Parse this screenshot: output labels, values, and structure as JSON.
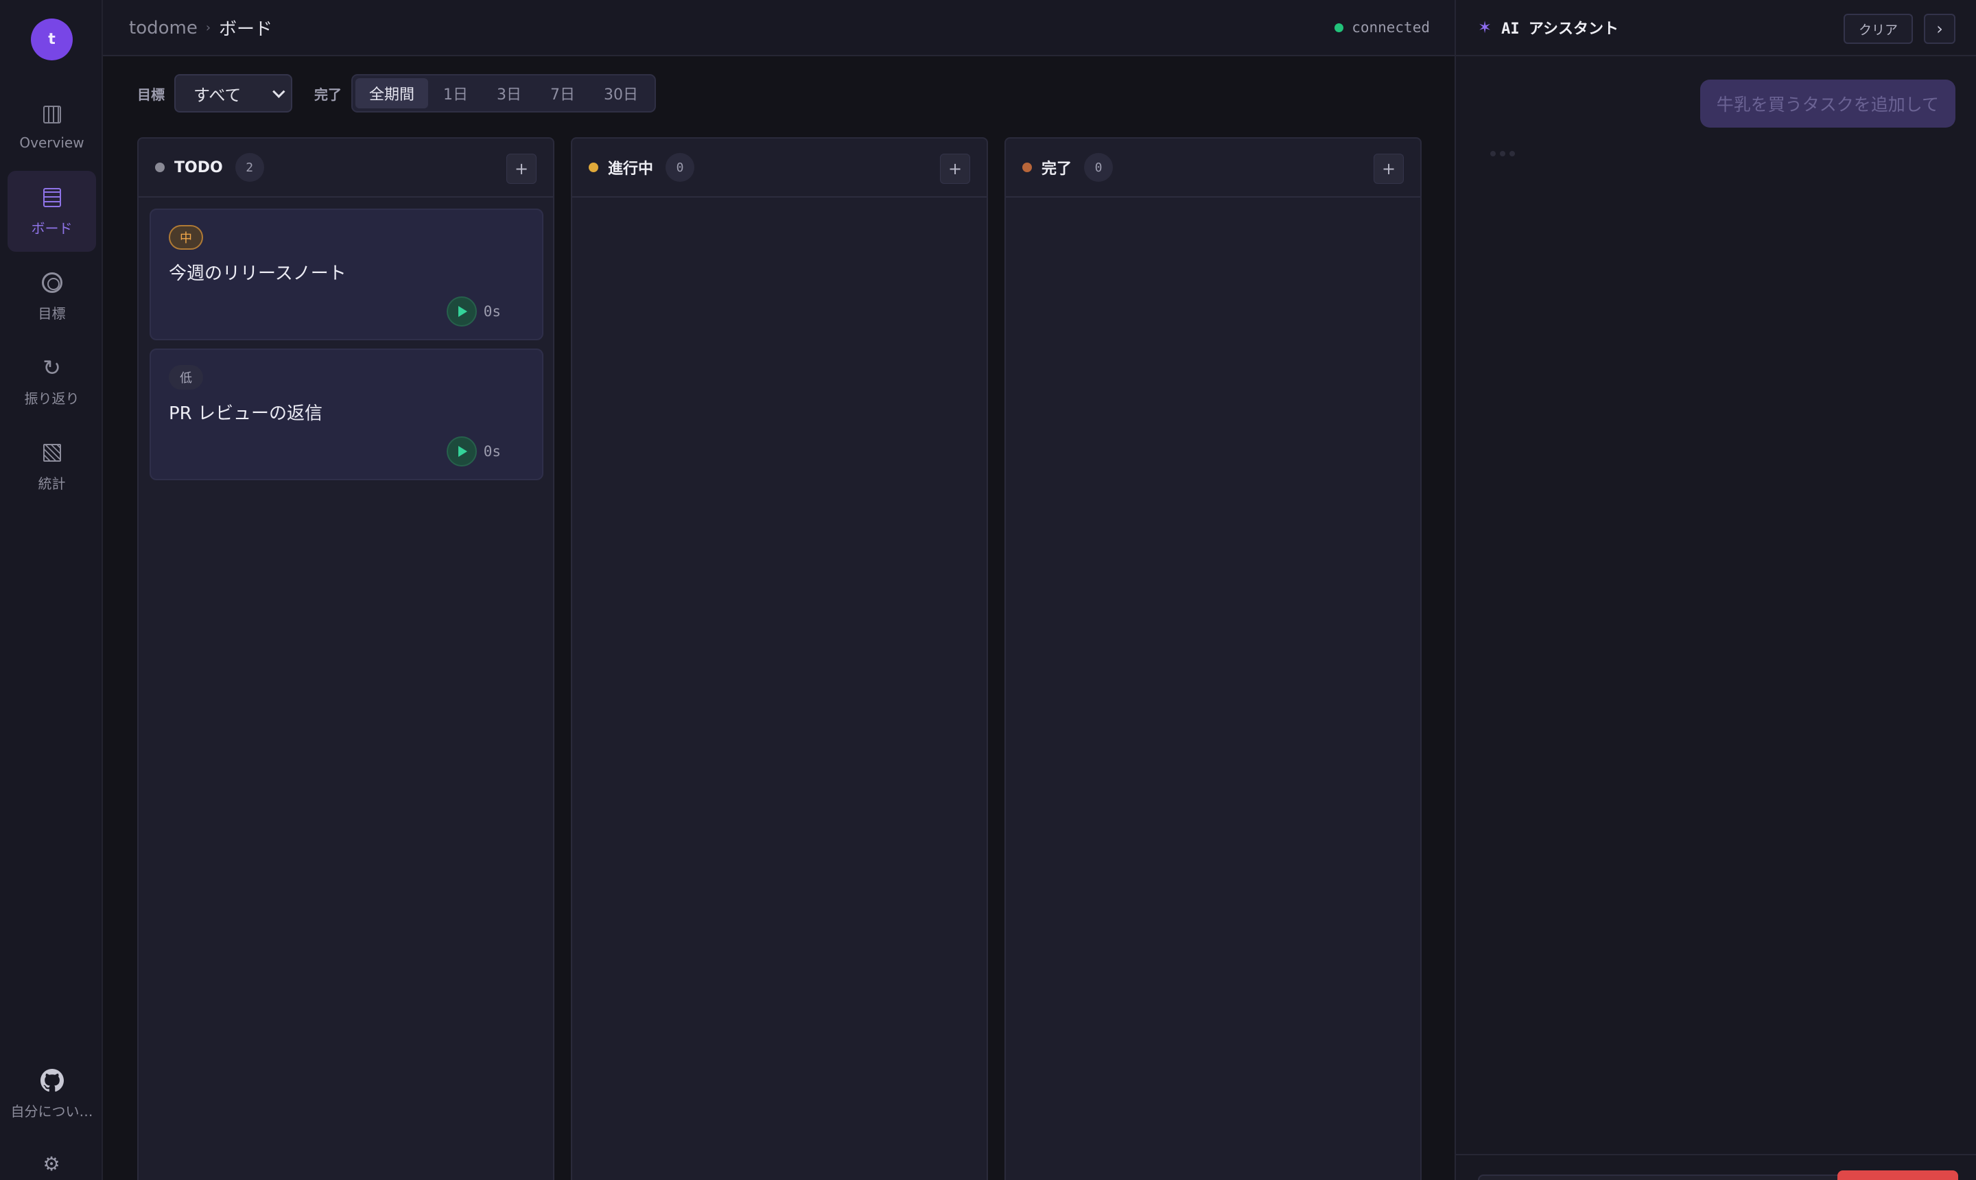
{
  "app": {
    "avatar_letter": "t",
    "brand": "todome",
    "page": "ボード",
    "status": "connected",
    "status_color": "#22c27a",
    "accent": "#7846e6"
  },
  "sidebar": {
    "items": [
      {
        "label": "Overview",
        "icon": "overview-grid-icon",
        "active": false
      },
      {
        "label": "ボード",
        "icon": "board-icon",
        "active": true
      },
      {
        "label": "目標",
        "icon": "target-icon",
        "active": false
      },
      {
        "label": "振り返り",
        "icon": "refresh-icon",
        "active": false
      },
      {
        "label": "統計",
        "icon": "stats-icon",
        "active": false
      }
    ],
    "about_label": "自分につい…",
    "about_icon": "github-icon",
    "settings_icon": "gear-icon"
  },
  "filters": {
    "goal_label": "目標",
    "goal_value": "すべて",
    "done_label": "完了",
    "periods": [
      "全期間",
      "1日",
      "3日",
      "7日",
      "30日"
    ],
    "active_period": "全期間"
  },
  "columns": [
    {
      "title": "TODO",
      "count": "2",
      "dot_color": "#8a8a96",
      "add": "+",
      "cards": [
        {
          "priority": "中",
          "title": "今週のリリースノート",
          "time": "0s"
        },
        {
          "priority": "低",
          "title": "PR レビューの返信",
          "time": "0s"
        }
      ]
    },
    {
      "title": "進行中",
      "count": "0",
      "dot_color": "#e0a93a",
      "add": "+",
      "cards": []
    },
    {
      "title": "完了",
      "count": "0",
      "dot_color": "#b8663a",
      "add": "+",
      "cards": []
    }
  ],
  "assistant": {
    "title": "AI アシスタント",
    "clear_label": "クリア",
    "collapse_icon": "chevron-right-icon",
    "user_message": "牛乳を買うタスクを追加して"
  }
}
